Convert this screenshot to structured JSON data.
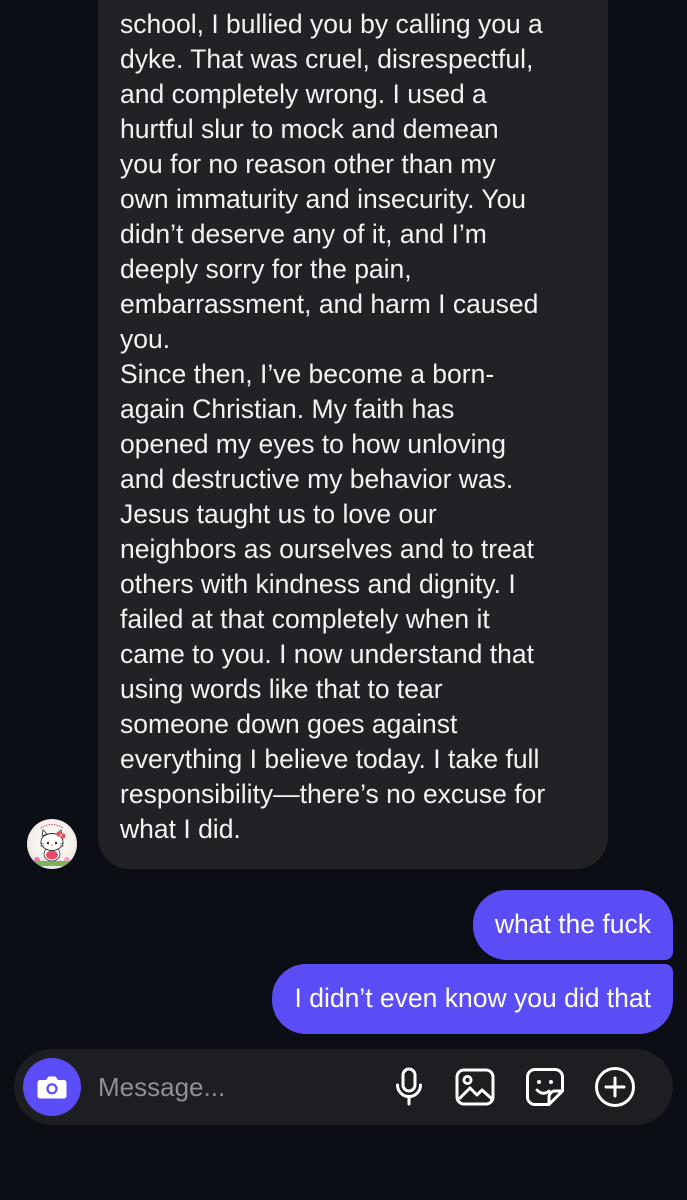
{
  "conversation": {
    "incoming_message": {
      "lines": [
        "school, I bullied you by calling you a",
        "dyke. That was cruel, disrespectful,",
        "and completely wrong. I used a",
        "hurtful slur to mock and demean",
        "you for no reason other than my",
        "own immaturity and insecurity. You",
        "didn’t deserve any of it, and I’m",
        "deeply sorry for the pain,",
        "embarrassment, and harm I caused",
        "you.",
        "Since then, I’ve become a born-",
        "again Christian. My faith has",
        "opened my eyes to how unloving",
        "and destructive my behavior was.",
        "Jesus taught us to love our",
        "neighbors as ourselves and to treat",
        "others with kindness and dignity. I",
        "failed at that completely when it",
        "came to you. I now understand that",
        "using words like that to tear",
        "someone down goes against",
        "everything I believe today. I take full",
        "responsibility—there’s no excuse for",
        "what I did."
      ]
    },
    "sender_avatar_icon": "hello-kitty-avatar-icon",
    "outgoing_messages": [
      "what the fuck",
      "I didn’t even know you did that"
    ]
  },
  "composer": {
    "placeholder": "Message...",
    "value": "",
    "icons": [
      "camera-icon",
      "microphone-icon",
      "image-icon",
      "sticker-icon",
      "plus-circle-icon"
    ]
  },
  "colors": {
    "background": "#0b0e14",
    "incoming_bubble": "#202226",
    "outgoing_bubble": "#5b4df5",
    "composer": "#1c1e22",
    "accent": "#5b4df5",
    "placeholder_text": "#8e9098"
  }
}
